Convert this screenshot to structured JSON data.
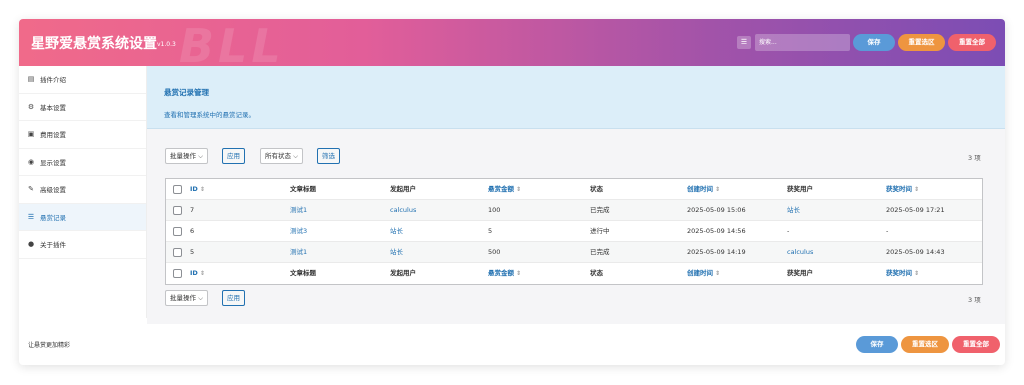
{
  "header": {
    "title": "星野爱悬赏系统设置",
    "version": "v1.0.3",
    "watermark": "BLL",
    "menu_icon": "list-icon",
    "search_placeholder": "搜索...",
    "save_label": "保存",
    "reset_section_label": "重置选区",
    "reset_all_label": "重置全部"
  },
  "sidebar": {
    "items": [
      {
        "label": "插件介绍",
        "icon": "book-icon"
      },
      {
        "label": "基本设置",
        "icon": "gears-icon"
      },
      {
        "label": "费用设置",
        "icon": "money-icon"
      },
      {
        "label": "显示设置",
        "icon": "eye-icon"
      },
      {
        "label": "高级设置",
        "icon": "wrench-icon"
      },
      {
        "label": "悬赏记录",
        "icon": "database-icon"
      },
      {
        "label": "关于插件",
        "icon": "info-icon"
      }
    ],
    "active_index": 5
  },
  "banner": {
    "title": "悬赏记录管理",
    "description": "查看和管理系统中的悬赏记录。"
  },
  "toolbar": {
    "bulk_label": "批量操作",
    "apply_label": "应用",
    "status_label": "所有状态",
    "filter_label": "筛选",
    "count": "3 项"
  },
  "table": {
    "columns": [
      "ID",
      "文章标题",
      "发起用户",
      "悬赏金额",
      "状态",
      "创建时间",
      "获奖用户",
      "获奖时间"
    ],
    "rows": [
      {
        "id": "7",
        "title": "测试1",
        "user": "calculus",
        "amount": "100",
        "status": "已完成",
        "created": "2025-05-09 15:06",
        "winner": "站长",
        "awarded": "2025-05-09 17:21"
      },
      {
        "id": "6",
        "title": "测试3",
        "user": "站长",
        "amount": "5",
        "status": "进行中",
        "created": "2025-05-09 14:56",
        "winner": "-",
        "awarded": "-"
      },
      {
        "id": "5",
        "title": "测试1",
        "user": "站长",
        "amount": "500",
        "status": "已完成",
        "created": "2025-05-09 14:19",
        "winner": "calculus",
        "awarded": "2025-05-09 14:43"
      }
    ]
  },
  "footer": {
    "text": "让悬赏更加精彩",
    "save_label": "保存",
    "reset_section_label": "重置选区",
    "reset_all_label": "重置全部"
  },
  "colors": {
    "accent": "#2271b1",
    "save": "#5a9ad8",
    "reset_section": "#ee9540",
    "reset_all": "#f0616c"
  }
}
